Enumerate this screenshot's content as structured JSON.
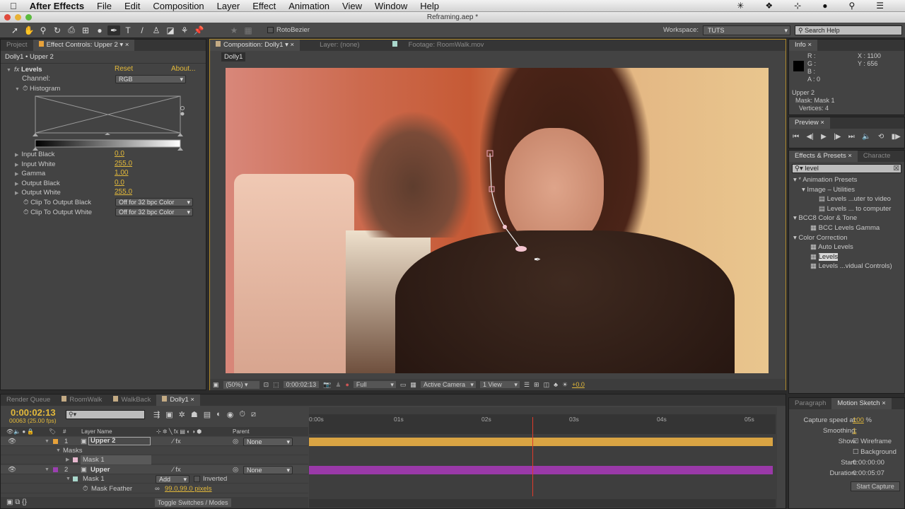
{
  "menubar": {
    "app": "After Effects",
    "items": [
      "File",
      "Edit",
      "Composition",
      "Layer",
      "Effect",
      "Animation",
      "View",
      "Window",
      "Help"
    ]
  },
  "window": {
    "title": "Reframing.aep *"
  },
  "toolbar": {
    "rotobezier": "RotoBezier",
    "workspace_label": "Workspace:",
    "workspace_value": "TUTS",
    "search_placeholder": "Search Help"
  },
  "left_panel": {
    "tabs": [
      "Project",
      "Effect Controls: Upper 2"
    ],
    "breadcrumb": "Dolly1 • Upper 2",
    "effect": {
      "name": "Levels",
      "reset": "Reset",
      "about": "About...",
      "channel_label": "Channel:",
      "channel_value": "RGB",
      "histogram_label": "Histogram",
      "params": [
        {
          "label": "Input Black",
          "value": "0.0"
        },
        {
          "label": "Input White",
          "value": "255.0"
        },
        {
          "label": "Gamma",
          "value": "1.00"
        },
        {
          "label": "Output Black",
          "value": "0.0"
        },
        {
          "label": "Output White",
          "value": "255.0"
        }
      ],
      "clips": [
        {
          "label": "Clip To Output Black",
          "value": "Off for 32 bpc Color"
        },
        {
          "label": "Clip To Output White",
          "value": "Off for 32 bpc Color"
        }
      ]
    }
  },
  "comp_panel": {
    "tabs": [
      "Composition: Dolly1",
      "Layer: (none)",
      "Footage: RoomWalk.mov"
    ],
    "comp_tab": "Dolly1",
    "footer": {
      "zoom": "(50%)",
      "timecode": "0:00:02:13",
      "resolution": "Full",
      "camera": "Active Camera",
      "views": "1 View",
      "exposure": "+0.0"
    }
  },
  "info": {
    "title": "Info",
    "r": "R :",
    "g": "G :",
    "b": "B :",
    "a": "A : 0",
    "x": "X : 1100",
    "y": "Y : 656",
    "layer": "Upper 2",
    "mask": "Mask: Mask 1",
    "vertices": "Vertices: 4"
  },
  "preview": {
    "title": "Preview"
  },
  "effects_presets": {
    "tabs": [
      "Effects & Presets",
      "Characte"
    ],
    "search": "level",
    "tree": [
      {
        "label": "* Animation Presets",
        "level": 0,
        "type": "folder"
      },
      {
        "label": "Image – Utilities",
        "level": 1,
        "type": "folder"
      },
      {
        "label": "Levels ...uter to video",
        "level": 2,
        "type": "preset"
      },
      {
        "label": "Levels ... to computer",
        "level": 2,
        "type": "preset"
      },
      {
        "label": "BCC8 Color & Tone",
        "level": 0,
        "type": "folder"
      },
      {
        "label": "BCC Levels Gamma",
        "level": 1,
        "type": "effect"
      },
      {
        "label": "Color Correction",
        "level": 0,
        "type": "folder"
      },
      {
        "label": "Auto Levels",
        "level": 1,
        "type": "effect"
      },
      {
        "label": "Levels",
        "level": 1,
        "type": "effect",
        "selected": true
      },
      {
        "label": "Levels ...vidual Controls)",
        "level": 1,
        "type": "effect"
      }
    ]
  },
  "timeline": {
    "tabs": [
      "Render Queue",
      "RoomWalk",
      "WalkBack",
      "Dolly1"
    ],
    "timecode": "0:00:02:13",
    "frames": "00063 (25.00 fps)",
    "headers": {
      "layer_name": "Layer Name",
      "num": "#",
      "parent": "Parent"
    },
    "ruler": [
      "0:00s",
      "01s",
      "02s",
      "03s",
      "04s",
      "05s"
    ],
    "playhead_seconds": 2.52,
    "rows": [
      {
        "num": "1",
        "name": "Upper 2",
        "parent": "None",
        "color": "#e8a23a"
      },
      {
        "label": "Masks"
      },
      {
        "name": "Mask 1",
        "color": "#e8b8cf"
      },
      {
        "num": "2",
        "name": "Upper",
        "parent": "None",
        "color": "#9b3fb0"
      },
      {
        "name": "Mask 1",
        "color": "#a9d7cc",
        "mode": "Add",
        "inverted": "Inverted"
      },
      {
        "name": "Mask Feather",
        "value": "99.0,99.0 pixels"
      }
    ],
    "toggle": "Toggle Switches / Modes"
  },
  "motion_sketch": {
    "tabs": [
      "Paragraph",
      "Motion Sketch"
    ],
    "capture_label": "Capture speed at:",
    "capture_value": "100",
    "capture_unit": "%",
    "smoothing_label": "Smoothing:",
    "smoothing_value": "1",
    "show_label": "Show:",
    "wireframe": "Wireframe",
    "background": "Background",
    "start_label": "Start:",
    "start_value": "0:00:00:00",
    "duration_label": "Duration:",
    "duration_value": "0:00:05:07",
    "button": "Start Capture"
  },
  "colors": {
    "accent": "#e3b93a",
    "layer1": "#d9a443",
    "layer2": "#9a39a8",
    "playhead": "#e03a2a"
  }
}
